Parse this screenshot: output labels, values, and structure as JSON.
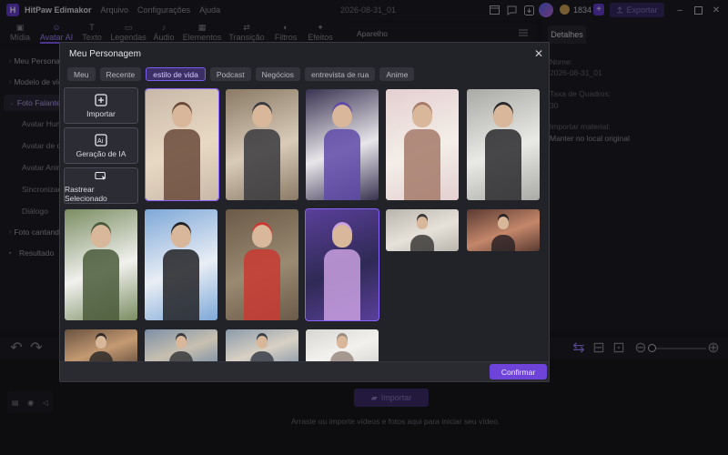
{
  "app": {
    "logo_letter": "H",
    "name": "HitPaw Edimakor",
    "menus": [
      "Arquivo",
      "Configurações",
      "Ajuda"
    ],
    "project_name": "2026-08-31_01",
    "credits": "1834",
    "export_label": "Exportar",
    "accent_color": "#8a62ff"
  },
  "tool_tabs": [
    {
      "label": "Mídia",
      "icon": "media-icon"
    },
    {
      "label": "Avatar AI",
      "icon": "avatar-ai-icon"
    },
    {
      "label": "Texto",
      "icon": "text-icon"
    },
    {
      "label": "Legendas",
      "icon": "subtitles-icon"
    },
    {
      "label": "Áudio",
      "icon": "audio-icon"
    },
    {
      "label": "Elementos",
      "icon": "elements-icon"
    },
    {
      "label": "Transição",
      "icon": "transition-icon"
    },
    {
      "label": "Filtros",
      "icon": "filters-icon"
    },
    {
      "label": "Efeitos",
      "icon": "effects-icon"
    }
  ],
  "sidebar": {
    "items": [
      "Meu Personagem",
      "Modelo de vídeo",
      "Foto Falante",
      "Foto cantando",
      "Resultado"
    ],
    "sub_items": [
      "Avatar Humano",
      "Avatar de desenho",
      "Avatar Animal",
      "Sincronização labial",
      "Diálogo"
    ]
  },
  "player": {
    "title": "Aparelho"
  },
  "details": {
    "tab_label": "Detalhes",
    "name_label": "Nome:",
    "name_value": "2026-08-31_01",
    "framerate_label": "Taxa de Quadros:",
    "framerate_value": "30",
    "import_label": "Importar material:",
    "import_value": "Manter no local original"
  },
  "timeline": {
    "import_label": "Importar",
    "drop_hint": "Arraste ou importe vídeos e fotos aqui para iniciar seu vídeo."
  },
  "modal": {
    "title": "Meu Personagem",
    "close_icon": "close-icon",
    "categories": [
      "Meu",
      "Recente",
      "estilo de vida",
      "Podcast",
      "Negócios",
      "entrevista de rua",
      "Anime"
    ],
    "active_category": "estilo de vida",
    "actions": [
      {
        "label": "Importar",
        "icon": "plus-square-icon"
      },
      {
        "label": "Geração de IA",
        "icon": "ai-icon"
      },
      {
        "label": "Rastrear Selecionado",
        "icon": "track-select-icon"
      }
    ],
    "confirm_label": "Confirmar",
    "avatars": [
      {
        "name": "woman-kitchen",
        "selected": true,
        "palette": [
          "#c9b8a8",
          "#e8d9c4",
          "#6a4a3a"
        ]
      },
      {
        "name": "man-cooking",
        "selected": false,
        "palette": [
          "#8a7a66",
          "#d8cbb8",
          "#3b3a40"
        ]
      },
      {
        "name": "man-hoodie-studio",
        "selected": false,
        "palette": [
          "#3a3352",
          "#e9e6ea",
          "#5f4aa8"
        ]
      },
      {
        "name": "woman-flowers",
        "selected": false,
        "palette": [
          "#e4cfd0",
          "#f3eee8",
          "#a57a6a"
        ]
      },
      {
        "name": "woman-gym",
        "selected": false,
        "palette": [
          "#a9a9a6",
          "#e9e9e6",
          "#2a2a2e"
        ]
      },
      {
        "name": "woman-white-outfit",
        "selected": false,
        "palette": [
          "#7a8d62",
          "#f1f1ee",
          "#4a5a3a"
        ]
      },
      {
        "name": "man-ski",
        "selected": false,
        "palette": [
          "#7ea8d8",
          "#e9eef5",
          "#222226"
        ]
      },
      {
        "name": "man-climbing",
        "selected": false,
        "palette": [
          "#6a5a48",
          "#9a8a72",
          "#c93a32"
        ]
      },
      {
        "name": "woman-neon-room",
        "selected": true,
        "palette": [
          "#5a3f9a",
          "#2f2a55",
          "#c9a0e0"
        ]
      },
      {
        "name": "woman-yoga",
        "selected": false,
        "palette": [
          "#b9b4ab",
          "#e6e2da",
          "#3c3a38"
        ]
      },
      {
        "name": "woman-desk-warm",
        "selected": false,
        "palette": [
          "#5a3a32",
          "#c4876a",
          "#2b2226"
        ]
      },
      {
        "name": "man-cafe",
        "selected": false,
        "palette": [
          "#6a5240",
          "#c49a72",
          "#2e2a28"
        ]
      },
      {
        "name": "woman-mountain",
        "selected": false,
        "palette": [
          "#7c8fa6",
          "#c8c0b0",
          "#3a3a3c"
        ]
      },
      {
        "name": "man-street",
        "selected": false,
        "palette": [
          "#8a9aaa",
          "#d9d1c4",
          "#3a3f4a"
        ]
      },
      {
        "name": "woman-bright-room",
        "selected": false,
        "palette": [
          "#d8d6d2",
          "#f2f1ee",
          "#9a8a80"
        ]
      }
    ]
  }
}
